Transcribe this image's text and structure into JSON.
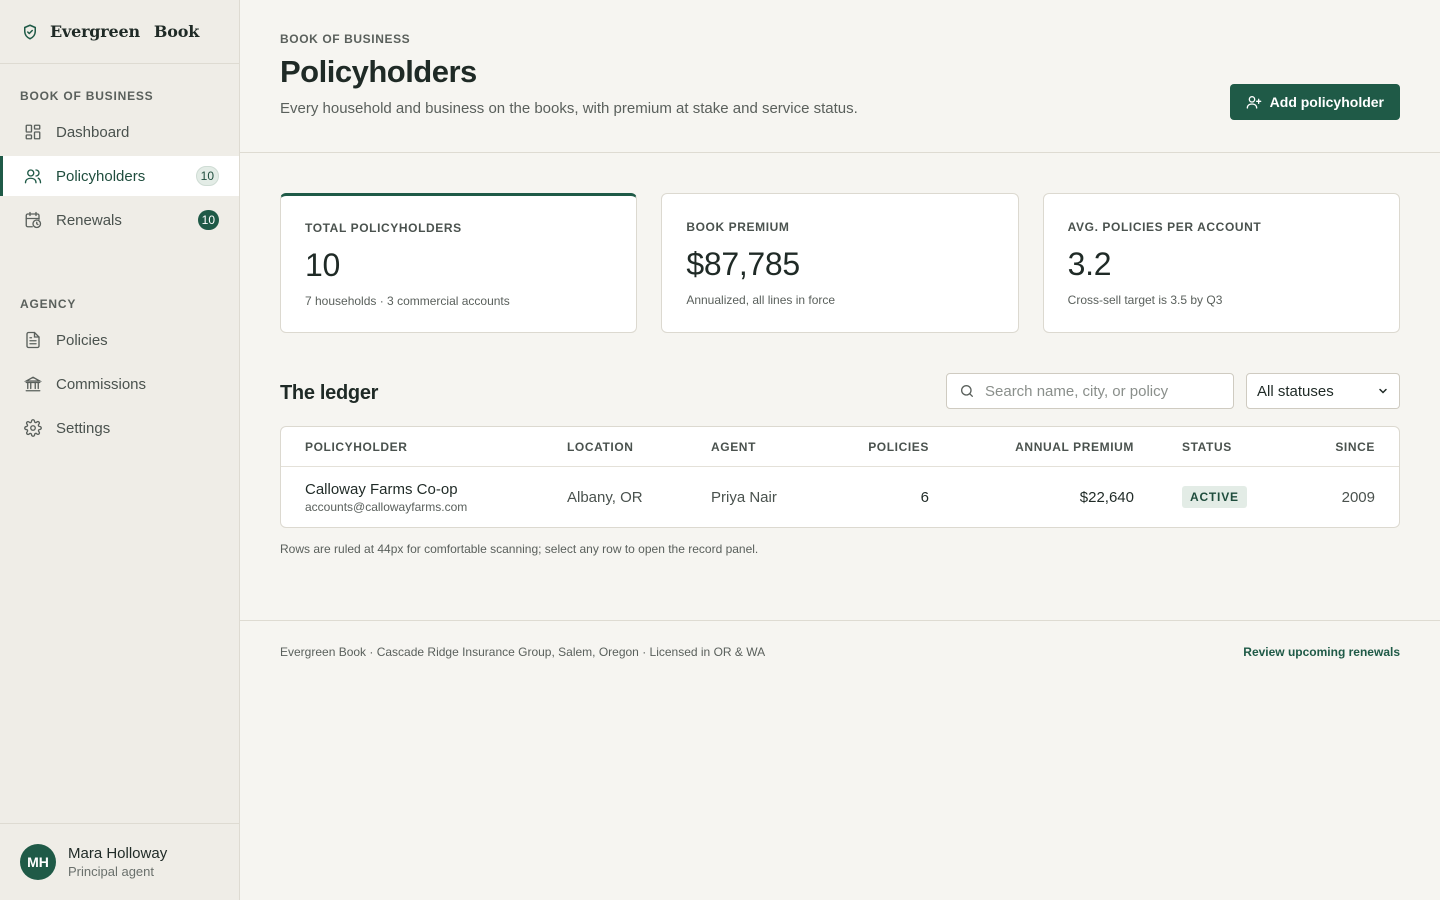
{
  "brand": {
    "name_part1": "Evergreen",
    "name_part2": "Book",
    "icon": "shield-check-icon"
  },
  "sidebar": {
    "section_book": "BOOK OF BUSINESS",
    "section_agency": "AGENCY",
    "items": [
      {
        "label": "Dashboard",
        "icon": "grid-icon"
      },
      {
        "label": "Policyholders",
        "icon": "users-icon",
        "badge": "10",
        "active": true
      },
      {
        "label": "Renewals",
        "icon": "calendar-clock-icon",
        "badge": "10"
      },
      {
        "label": "Policies",
        "icon": "document-icon"
      },
      {
        "label": "Commissions",
        "icon": "bank-icon"
      },
      {
        "label": "Settings",
        "icon": "gear-icon"
      }
    ],
    "user": {
      "initials": "MH",
      "name": "Mara Holloway",
      "role": "Principal agent"
    }
  },
  "header": {
    "eyebrow": "BOOK OF BUSINESS",
    "title": "Policyholders",
    "subtitle": "Every household and business on the books, with premium at stake and service status.",
    "add_button": "Add policyholder"
  },
  "stats": [
    {
      "label": "TOTAL POLICYHOLDERS",
      "value": "10",
      "note": "7 households · 3 commercial accounts"
    },
    {
      "label": "BOOK PREMIUM",
      "value": "$87,785",
      "note": "Annualized, all lines in force"
    },
    {
      "label": "AVG. POLICIES PER ACCOUNT",
      "value": "3.2",
      "note": "Cross-sell target is 3.5 by Q3"
    }
  ],
  "ledger": {
    "title": "The ledger",
    "search_placeholder": "Search name, city, or policy",
    "status_filter": "All statuses",
    "columns": {
      "holder": "POLICYHOLDER",
      "location": "LOCATION",
      "agent": "AGENT",
      "policies": "POLICIES",
      "premium": "ANNUAL PREMIUM",
      "status": "STATUS",
      "since": "SINCE"
    },
    "rows": [
      {
        "name": "Calloway Farms Co-op",
        "email": "accounts@callowayfarms.com",
        "location": "Albany, OR",
        "agent": "Priya Nair",
        "policies": "6",
        "premium": "$22,640",
        "status": "ACTIVE",
        "since": "2009"
      }
    ],
    "note": "Rows are ruled at 44px for comfortable scanning; select any row to open the record panel."
  },
  "footer": {
    "text": "Evergreen Book · Cascade Ridge Insurance Group, Salem, Oregon · Licensed in OR & WA",
    "link": "Review upcoming renewals"
  },
  "colors": {
    "accent": "#1f5a47",
    "background": "#f6f5f1",
    "sidebar": "#efede7"
  }
}
